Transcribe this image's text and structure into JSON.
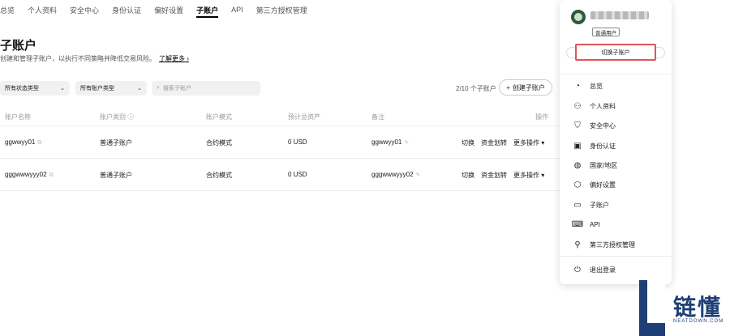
{
  "nav": {
    "tabs": [
      "总览",
      "个人资料",
      "安全中心",
      "身份认证",
      "偏好设置",
      "子账户",
      "API",
      "第三方授权管理"
    ],
    "active": "子账户"
  },
  "page": {
    "title": "子账户",
    "desc": "创建和管理子账户，以执行不同策略并降低交易风险。",
    "learn_more": "了解更多 ›"
  },
  "filters": {
    "status": "所有状态类型",
    "account_type": "所有账户类型",
    "search_placeholder": "搜索子账户"
  },
  "count": "2/10 个子账户",
  "create_label": "创建子账户",
  "table": {
    "headers": [
      "账户名称",
      "账户类别",
      "账户模式",
      "预计总资产",
      "备注",
      "操作"
    ],
    "rows": [
      {
        "name": "ggwwyy01",
        "category": "普通子账户",
        "mode": "合约模式",
        "assets": "0 USD",
        "note": "ggwwyy01",
        "op1": "切换",
        "op2": "资金划转",
        "op3": "更多操作 ▾"
      },
      {
        "name": "gggwwwyyy02",
        "category": "普通子账户",
        "mode": "合约模式",
        "assets": "0 USD",
        "note": "gggwwwyyy02",
        "op1": "切换",
        "op2": "资金划转",
        "op3": "更多操作 ▾"
      }
    ]
  },
  "panel": {
    "badge": "普通用户",
    "switch": "切换子账户",
    "items": [
      "总览",
      "个人资料",
      "安全中心",
      "身份认证",
      "国家/地区",
      "偏好设置",
      "子账户",
      "API",
      "第三方授权管理"
    ],
    "logout": "退出登录"
  },
  "watermark": {
    "text": "链懂",
    "sub": "NEATDOWN.COM"
  },
  "colors": {
    "highlight": "#e05555",
    "brand": "#1e3f75"
  }
}
